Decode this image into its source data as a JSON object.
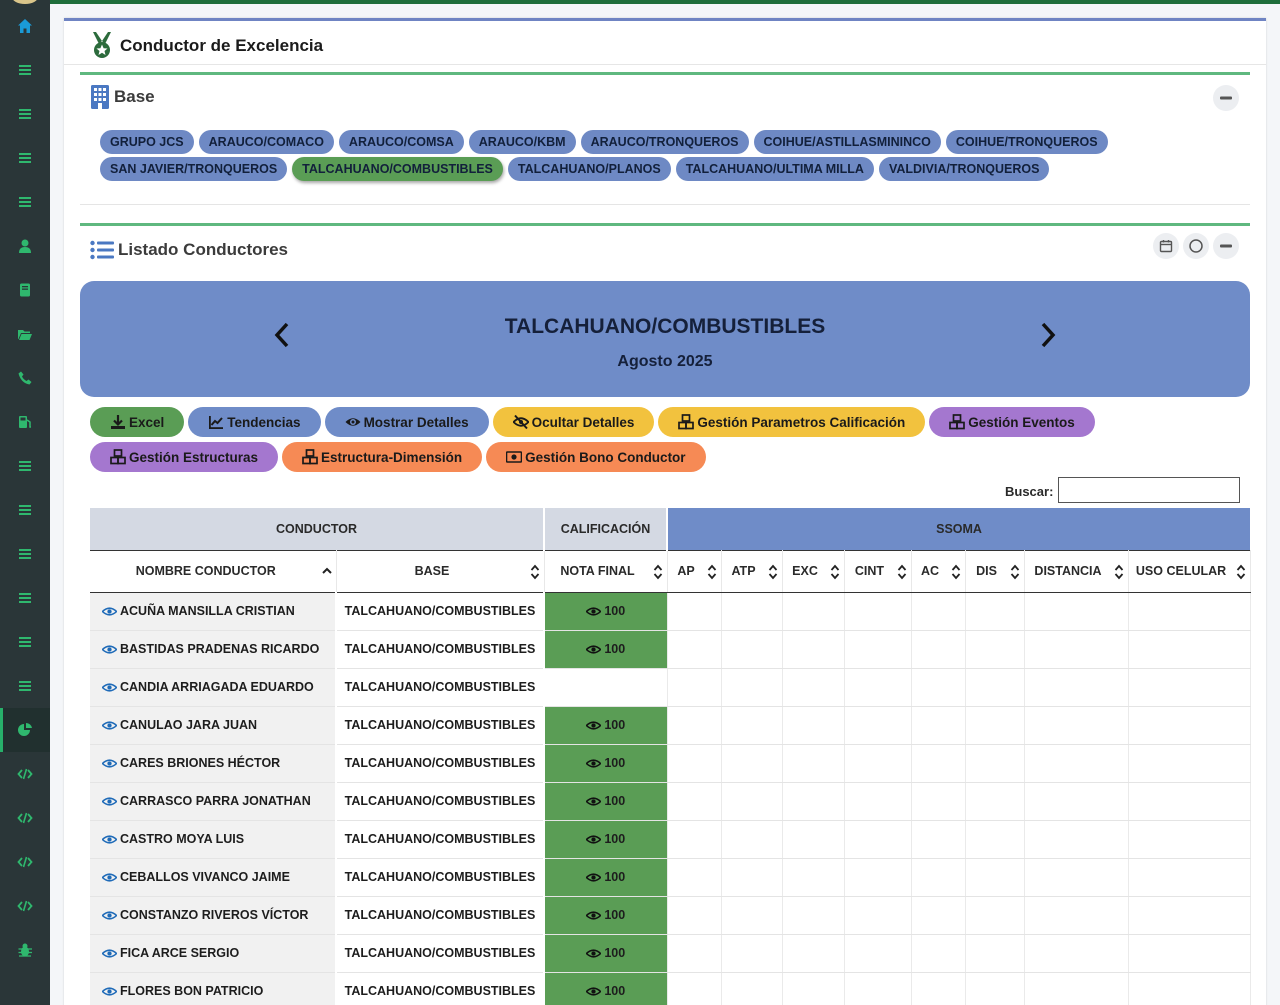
{
  "colors": {
    "sidebar": "#2a3638",
    "accent_green": "#5fb87f",
    "accent_blue": "#6f8cc8",
    "grade_green": "#5a9d55"
  },
  "sidebar": {
    "icons": [
      "home-icon",
      "list-icon",
      "list-icon",
      "list-icon",
      "list-icon",
      "user-icon",
      "book-icon",
      "folder-open-icon",
      "phone-icon",
      "gas-pump-icon",
      "list-icon",
      "list-icon",
      "list-icon",
      "list-icon",
      "list-icon",
      "list-icon",
      "chart-pie-icon",
      "code-icon",
      "code-icon",
      "code-icon",
      "code-icon",
      "bug-icon"
    ]
  },
  "page": {
    "title": "Conductor de Excelencia"
  },
  "base_card": {
    "title": "Base",
    "chips": [
      {
        "label": "GRUPO JCS",
        "active": false
      },
      {
        "label": "ARAUCO/COMACO",
        "active": false
      },
      {
        "label": "ARAUCO/COMSA",
        "active": false
      },
      {
        "label": "ARAUCO/KBM",
        "active": false
      },
      {
        "label": "ARAUCO/TRONQUEROS",
        "active": false
      },
      {
        "label": "COIHUE/ASTILLASMININCO",
        "active": false
      },
      {
        "label": "COIHUE/TRONQUEROS",
        "active": false
      },
      {
        "label": "SAN JAVIER/TRONQUEROS",
        "active": false
      },
      {
        "label": "TALCAHUANO/COMBUSTIBLES",
        "active": true
      },
      {
        "label": "TALCAHUANO/PLANOS",
        "active": false
      },
      {
        "label": "TALCAHUANO/ULTIMA MILLA",
        "active": false
      },
      {
        "label": "VALDIVIA/TRONQUEROS",
        "active": false
      }
    ]
  },
  "list_card": {
    "title": "Listado Conductores",
    "banner": {
      "title": "TALCAHUANO/COMBUSTIBLES",
      "subtitle": "Agosto 2025"
    },
    "actions": [
      {
        "label": "Excel",
        "color": "#5a9d55",
        "icon": "download-icon"
      },
      {
        "label": "Tendencias",
        "color": "#6f8cc8",
        "icon": "chart-line-icon"
      },
      {
        "label": "Mostrar Detalles",
        "color": "#6f8cc8",
        "icon": "eye-icon"
      },
      {
        "label": "Ocultar Detalles",
        "color": "#f2c23e",
        "icon": "eye-slash-icon"
      },
      {
        "label": "Gestión Parametros Calificación",
        "color": "#f2c23e",
        "icon": "cubes-icon"
      },
      {
        "label": "Gestión Eventos",
        "color": "#a477cf",
        "icon": "cubes-icon"
      },
      {
        "label": "Gestión Estructuras",
        "color": "#a477cf",
        "icon": "cubes-icon"
      },
      {
        "label": "Estructura-Dimensión",
        "color": "#f68a55",
        "icon": "cubes-icon"
      },
      {
        "label": "Gestión Bono Conductor",
        "color": "#f68a55",
        "icon": "money-bill-icon"
      }
    ],
    "search_label": "Buscar:",
    "search_value": "",
    "table": {
      "groups": {
        "conductor": "CONDUCTOR",
        "calificacion": "CALIFICACIÓN",
        "ssoma": "SSOMA"
      },
      "columns": [
        "NOMBRE CONDUCTOR",
        "BASE",
        "NOTA FINAL",
        "AP",
        "ATP",
        "EXC",
        "CINT",
        "AC",
        "DIS",
        "DISTANCIA",
        "USO CELULAR"
      ],
      "rows": [
        {
          "name": "ACUÑA MANSILLA CRISTIAN",
          "base": "TALCAHUANO/COMBUSTIBLES",
          "nota": "100"
        },
        {
          "name": "BASTIDAS PRADENAS RICARDO",
          "base": "TALCAHUANO/COMBUSTIBLES",
          "nota": "100"
        },
        {
          "name": "CANDIA ARRIAGADA EDUARDO",
          "base": "TALCAHUANO/COMBUSTIBLES",
          "nota": ""
        },
        {
          "name": "CANULAO JARA JUAN",
          "base": "TALCAHUANO/COMBUSTIBLES",
          "nota": "100"
        },
        {
          "name": "CARES BRIONES HÉCTOR",
          "base": "TALCAHUANO/COMBUSTIBLES",
          "nota": "100"
        },
        {
          "name": "CARRASCO PARRA JONATHAN",
          "base": "TALCAHUANO/COMBUSTIBLES",
          "nota": "100"
        },
        {
          "name": "CASTRO MOYA LUIS",
          "base": "TALCAHUANO/COMBUSTIBLES",
          "nota": "100"
        },
        {
          "name": "CEBALLOS VIVANCO JAIME",
          "base": "TALCAHUANO/COMBUSTIBLES",
          "nota": "100"
        },
        {
          "name": "CONSTANZO RIVEROS VÍCTOR",
          "base": "TALCAHUANO/COMBUSTIBLES",
          "nota": "100"
        },
        {
          "name": "FICA ARCE SERGIO",
          "base": "TALCAHUANO/COMBUSTIBLES",
          "nota": "100"
        },
        {
          "name": "FLORES BON PATRICIO",
          "base": "TALCAHUANO/COMBUSTIBLES",
          "nota": "100"
        }
      ]
    }
  }
}
